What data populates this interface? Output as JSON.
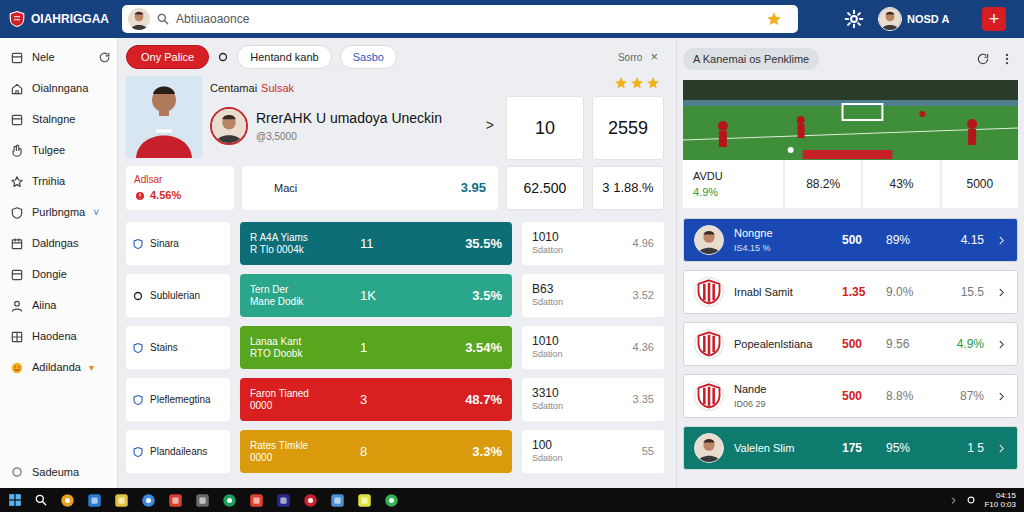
{
  "header": {
    "logo": "OIAHRIGGAA",
    "search": {
      "placeholder": "Abtiuaoaonce"
    },
    "user": "NOSD A",
    "add_button": "+"
  },
  "sidebar": {
    "items": [
      {
        "label": "Nele",
        "selected": false
      },
      {
        "label": "Oialnngana",
        "selected": false
      },
      {
        "label": "Stalngne",
        "selected": false
      },
      {
        "label": "Tulgee",
        "selected": false
      },
      {
        "label": "Trnihia",
        "selected": false
      },
      {
        "label": "Purlbngma",
        "selected": false,
        "suffix": "˅"
      },
      {
        "label": "Daldngas",
        "selected": false
      },
      {
        "label": "Dongie",
        "selected": false
      },
      {
        "label": "Aiina",
        "selected": false
      },
      {
        "label": "Haodena",
        "selected": false
      },
      {
        "label": "Adildanda",
        "selected": false,
        "suffix": "▾"
      }
    ],
    "footer": "Sadeuma"
  },
  "tabs": [
    {
      "label": "Ony Palice",
      "selected": true
    },
    {
      "label": "Hentand kanb",
      "selected": false
    },
    {
      "label": "Sasbo",
      "selected": false
    }
  ],
  "sort": {
    "label": "Sorro",
    "close": "×"
  },
  "profile": {
    "title": "Centamai",
    "title_accent": "Sulsak",
    "stars": 3,
    "name": "RrerAHK U umadoya Uneckin",
    "handle": "@3,5000",
    "arrow": ">",
    "count": "10",
    "score": "2559"
  },
  "summary": {
    "alert_label": "Adlsar",
    "alert_value": "4.56%",
    "metric_label": "Maci",
    "metric_value": "3.95",
    "total": "62.500",
    "ratio": "3 1.88.%"
  },
  "rows": [
    {
      "label": "Sinara",
      "title": "R A4A Yiams",
      "subtitle": "R Tlo 0004k",
      "count": "11",
      "percent": "35.5%",
      "color": "#0e6e78",
      "code": "1010",
      "code_label": "Sdatton",
      "value": "4.96"
    },
    {
      "label": "Sublulerian",
      "title": "Tern Der",
      "subtitle": "Mane Dodik",
      "count": "1K",
      "percent": "3.5%",
      "color": "#2aa68a",
      "code": "B63",
      "code_label": "Sdatton",
      "value": "3.52"
    },
    {
      "label": "Stains",
      "title": "Lanaa Kant",
      "subtitle": "RTO Doobk",
      "count": "1",
      "percent": "3.54%",
      "color": "#58a61e",
      "code": "1010",
      "code_label": "Sdation",
      "value": "4.36"
    },
    {
      "label": "Pleflemegtina",
      "title": "Faron Tianed",
      "subtitle": "0000",
      "count": "3",
      "percent": "48.7%",
      "color": "#d91f1f",
      "code": "3310",
      "code_label": "Sdatton",
      "value": "3.35"
    },
    {
      "label": "Plandaileans",
      "title": "Rates Tlmkle",
      "subtitle": "0000",
      "count": "8",
      "percent": "3.3%",
      "color": "#d99a0b",
      "code": "100",
      "code_label": "Sdation",
      "value": "55"
    }
  ],
  "side_panel": {
    "title": "A Kanemai os Penklime",
    "stats": {
      "label": "AVDU",
      "change": "4.9%",
      "values": [
        "88.2%",
        "43%",
        "5000"
      ]
    },
    "players": [
      {
        "name": "Nongne",
        "sub": "IS4.15 %",
        "value": "500",
        "percent": "89%",
        "score": "4.15",
        "kind": "photo",
        "up": false,
        "color": "#1a49b3"
      },
      {
        "name": "Irnabl Samit",
        "value": "1.35",
        "percent": "9.0%",
        "score": "15.5",
        "kind": "club",
        "up": false,
        "color": "#ffffff"
      },
      {
        "name": "Popealenlstiana",
        "value": "500",
        "percent": "9.56",
        "score": "4.9%",
        "kind": "club",
        "up": true,
        "color": "#ffffff"
      },
      {
        "name": "Nande",
        "sub": "ID06 29",
        "value": "500",
        "percent": "8.8%",
        "score": "87%",
        "kind": "club",
        "up": false,
        "color": "#ffffff"
      },
      {
        "name": "Valelen Slim",
        "value": "175",
        "percent": "95%",
        "score": "1 5",
        "kind": "photo",
        "up": false,
        "color": "#0f7a6e"
      }
    ]
  },
  "taskbar": {
    "time": "04:15",
    "date": "F10 0:03"
  }
}
